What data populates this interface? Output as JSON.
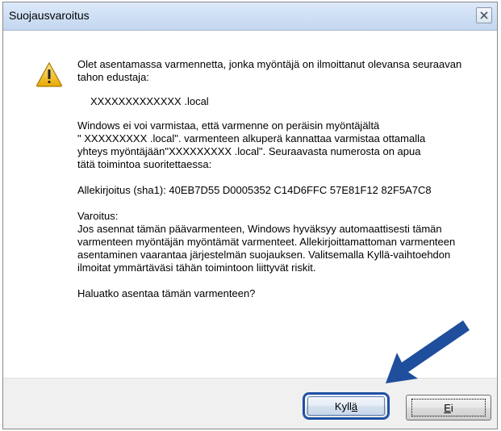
{
  "dialog": {
    "title": "Suojausvaroitus",
    "close_icon": "close-icon",
    "warning_icon": "warning-triangle-icon"
  },
  "message": {
    "intro": "Olet asentamassa varmennetta, jonka myöntäjä on ilmoittanut olevansa seuraavan tahon edustaja:",
    "host": "XXXXXXXXXXXXX .local",
    "verify_line1": "Windows ei voi varmistaa, että varmenne on peräisin myöntäjältä",
    "verify_line2": "\" XXXXXXXXX .local\". varmenteen alkuperä kannattaa varmistaa ottamalla",
    "verify_line3": "yhteys myöntäjään\"XXXXXXXXX .local\". Seuraavasta numerosta on apua",
    "verify_line4": "tätä toimintoa suoritettaessa:",
    "thumbprint": "Allekirjoitus (sha1): 40EB7D55 D0005352 C14D6FFC 57E81F12 82F5A7C8",
    "warning_heading": "Varoitus:",
    "warning_body": "Jos asennat tämän päävarmenteen, Windows hyväksyy automaattisesti tämän varmenteen myöntäjän myöntämät varmenteet. Allekirjoittamattoman varmenteen asentaminen vaarantaa järjestelmän suojauksen. Valitsemalla Kyllä-vaihtoehdon ilmoitat ymmärtäväsi tähän toimintoon liittyvät riskit.",
    "question": "Haluatko asentaa tämän varmenteen?"
  },
  "buttons": {
    "yes_prefix": "Kyll",
    "yes_accel": "ä",
    "no_prefix": "",
    "no_accel": "E",
    "no_suffix": "i"
  },
  "colors": {
    "accent_arrow": "#1f4e9c",
    "focus_border": "#1d4fa3"
  }
}
